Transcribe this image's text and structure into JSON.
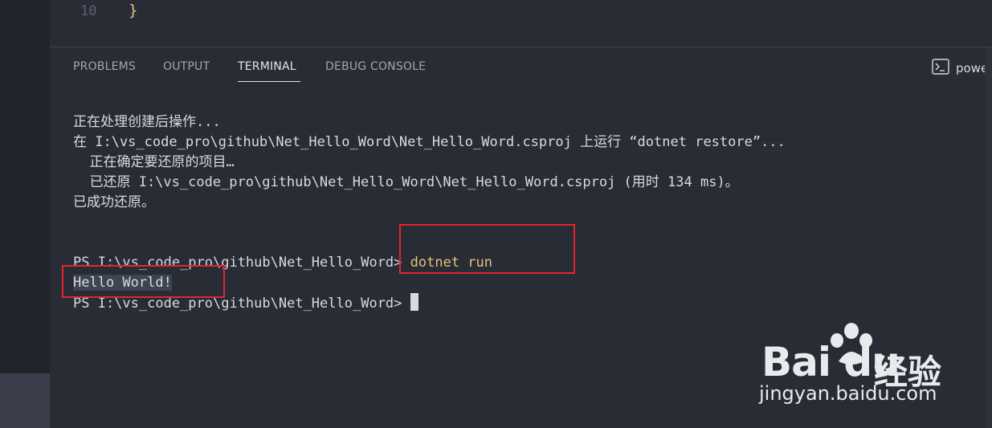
{
  "editor": {
    "line_number": "10",
    "code": "}"
  },
  "panel": {
    "tabs": [
      {
        "label": "PROBLEMS",
        "active": false
      },
      {
        "label": "OUTPUT",
        "active": false
      },
      {
        "label": "TERMINAL",
        "active": true
      },
      {
        "label": "DEBUG CONSOLE",
        "active": false
      }
    ],
    "shell_label": "powers"
  },
  "terminal": {
    "lines": [
      "正在处理创建后操作...",
      "在 I:\\vs_code_pro\\github\\Net_Hello_Word\\Net_Hello_Word.csproj 上运行 “dotnet restore”...",
      "  正在确定要还原的项目…",
      "  已还原 I:\\vs_code_pro\\github\\Net_Hello_Word\\Net_Hello_Word.csproj (用时 134 ms)。",
      "已成功还原。",
      ""
    ],
    "prompt": "PS I:\\vs_code_pro\\github\\Net_Hello_Word> ",
    "command": "dotnet run",
    "output": "Hello World!"
  },
  "watermark": {
    "brand": "Bai du",
    "brand_cn": "经验",
    "url": "jingyan.baidu.com"
  },
  "colors": {
    "background": "#282c34",
    "activity_bar": "#21252b",
    "command": "#e5c07b",
    "annotation_box": "#e8232f",
    "text": "#d7dae0"
  }
}
